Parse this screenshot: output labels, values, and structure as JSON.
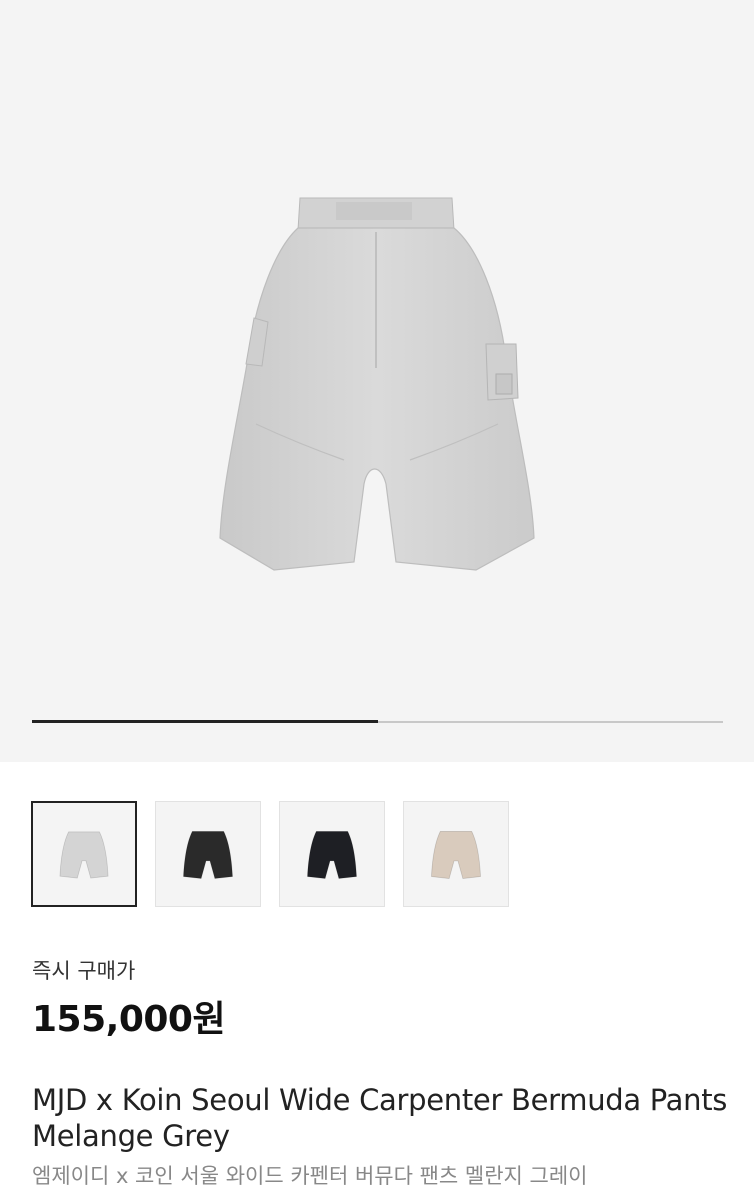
{
  "gallery": {
    "progress": 0.5,
    "hero_image": "grey-bermuda-shorts-photo",
    "thumbnails": [
      {
        "name": "thumbnail-grey",
        "color": "#d4d4d4",
        "selected": true
      },
      {
        "name": "thumbnail-black",
        "color": "#2a2a2a",
        "selected": false
      },
      {
        "name": "thumbnail-black-detail",
        "color": "#1e1f24",
        "selected": false
      },
      {
        "name": "thumbnail-beige",
        "color": "#d9cbbd",
        "selected": false
      }
    ]
  },
  "price": {
    "label": "즉시 구매가",
    "value": "155,000원"
  },
  "product": {
    "title": "MJD x Koin Seoul Wide Carpenter Bermuda Pants Melange Grey",
    "subtitle": "엠제이디 x 코인 서울 와이드 카펜터 버뮤다 팬츠 멜란지 그레이"
  },
  "colors": {
    "hero_bg": "#f4f4f4",
    "shorts_grey": "#d6d6d6",
    "progress_active": "#222222",
    "progress_track": "#c8c8c8"
  }
}
